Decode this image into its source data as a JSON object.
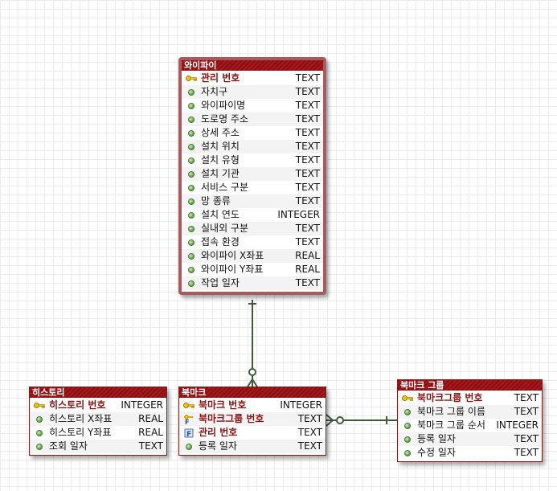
{
  "entities": {
    "wifi": {
      "title": "와이파이",
      "columns": [
        {
          "name": "관리 번호",
          "type": "TEXT",
          "kind": "pk"
        },
        {
          "name": "자치구",
          "type": "TEXT",
          "kind": "col"
        },
        {
          "name": "와이파이명",
          "type": "TEXT",
          "kind": "col"
        },
        {
          "name": "도로명 주소",
          "type": "TEXT",
          "kind": "col"
        },
        {
          "name": "상세 주소",
          "type": "TEXT",
          "kind": "col"
        },
        {
          "name": "설치 위치",
          "type": "TEXT",
          "kind": "col"
        },
        {
          "name": "설치 유형",
          "type": "TEXT",
          "kind": "col"
        },
        {
          "name": "설치 기관",
          "type": "TEXT",
          "kind": "col"
        },
        {
          "name": "서비스 구분",
          "type": "TEXT",
          "kind": "col"
        },
        {
          "name": "망 종류",
          "type": "TEXT",
          "kind": "col"
        },
        {
          "name": "설치 연도",
          "type": "INTEGER",
          "kind": "col"
        },
        {
          "name": "실내외 구분",
          "type": "TEXT",
          "kind": "col"
        },
        {
          "name": "접속 환경",
          "type": "TEXT",
          "kind": "col"
        },
        {
          "name": "와이파이 X좌표",
          "type": "REAL",
          "kind": "col"
        },
        {
          "name": "와이파이 Y좌표",
          "type": "REAL",
          "kind": "col"
        },
        {
          "name": "작업 일자",
          "type": "TEXT",
          "kind": "col"
        }
      ]
    },
    "history": {
      "title": "히스토리",
      "columns": [
        {
          "name": "히스토리 번호",
          "type": "INTEGER",
          "kind": "pk"
        },
        {
          "name": "히스토리 X좌표",
          "type": "REAL",
          "kind": "col"
        },
        {
          "name": "히스토리 Y좌표",
          "type": "REAL",
          "kind": "col"
        },
        {
          "name": "조회 일자",
          "type": "TEXT",
          "kind": "col"
        }
      ]
    },
    "bookmark": {
      "title": "북마크",
      "columns": [
        {
          "name": "북마크 번호",
          "type": "INTEGER",
          "kind": "pk"
        },
        {
          "name": "북마크그룹 번호",
          "type": "TEXT",
          "kind": "pkfk"
        },
        {
          "name": "관리 번호",
          "type": "TEXT",
          "kind": "fk"
        },
        {
          "name": "등록 일자",
          "type": "TEXT",
          "kind": "col"
        }
      ]
    },
    "bookmark_group": {
      "title": "북마크 그룹",
      "columns": [
        {
          "name": "북마크그룹 번호",
          "type": "TEXT",
          "kind": "pk"
        },
        {
          "name": "북마크 그룹 이름",
          "type": "TEXT",
          "kind": "col"
        },
        {
          "name": "북마크 그룹 순서",
          "type": "INTEGER",
          "kind": "col"
        },
        {
          "name": "등록 일자",
          "type": "TEXT",
          "kind": "col"
        },
        {
          "name": "수정 일자",
          "type": "TEXT",
          "kind": "col"
        }
      ]
    }
  },
  "colors": {
    "header": "#8b0f12",
    "pk_text": "#8b1010",
    "relation_line": "#3e5a37",
    "selected_border": "#a85a5e"
  },
  "relationships": [
    {
      "from": "wifi",
      "to": "bookmark",
      "cardinality": "one-to-zero-or-many"
    },
    {
      "from": "bookmark_group",
      "to": "bookmark",
      "cardinality": "one-to-zero-or-many"
    }
  ]
}
